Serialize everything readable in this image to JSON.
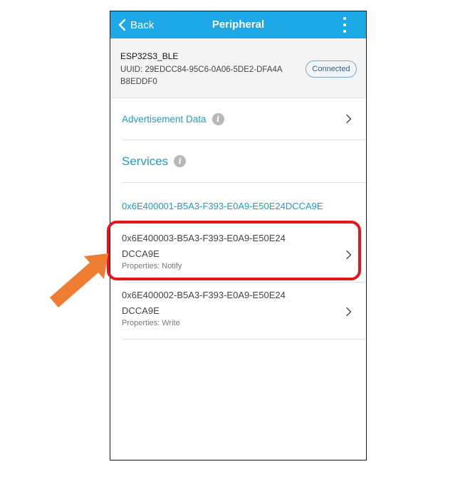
{
  "navbar": {
    "back_label": "Back",
    "title": "Peripheral",
    "color": "#1da8e8"
  },
  "device": {
    "name": "ESP32S3_BLE",
    "uuid": "UUID: 29EDCC84-95C6-0A06-5DE2-DFA4AB8EDDF0",
    "status": "Connected"
  },
  "advertisement": {
    "label": "Advertisement Data"
  },
  "services": {
    "heading": "Services",
    "service_uuid": "0x6E400001-B5A3-F393-E0A9-E50E24DCCA9E",
    "characteristics": [
      {
        "uuid": "0x6E400003-B5A3-F393-E0A9-E50E24DCCA9E",
        "properties": "Properties: Notify",
        "highlighted": true
      },
      {
        "uuid": "0x6E400002-B5A3-F393-E0A9-E50E24DCCA9E",
        "properties": "Properties: Write",
        "highlighted": false
      }
    ]
  },
  "annotation": {
    "highlight_color": "#e8141b",
    "arrow_color": "#ef7d31"
  },
  "icons": {
    "back": "chevron-left-icon",
    "more": "more-vertical-icon",
    "info": "info-icon",
    "row": "chevron-right-icon"
  }
}
